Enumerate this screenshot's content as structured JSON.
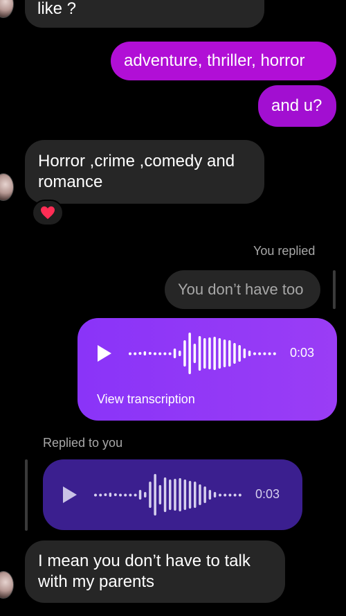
{
  "messages": {
    "m1_text": "like ?",
    "m2_text": "adventure, thriller, horror",
    "m3_text": "and u?",
    "m4_line1": "Horror ,crime ,comedy and",
    "m4_line2": "romance",
    "reaction_icon": "heart-icon",
    "you_replied_label": "You replied",
    "quoted_text": "You don’t have too",
    "voice1_time": "0:03",
    "voice1_link": "View transcription",
    "replied_to_you_label": "Replied to you",
    "voice2_time": "0:03",
    "m5_line1": "I mean you don’t have to talk",
    "m5_line2": "with my parents"
  },
  "colors": {
    "incoming_bubble": "#262626",
    "outgoing_magenta": "#a20fd1",
    "voice_gradient_start": "#7b2ff7",
    "voice_gradient_end": "#9a3df5",
    "quoted_voice": "#3b1f8f",
    "heart": "#ff2d55"
  }
}
